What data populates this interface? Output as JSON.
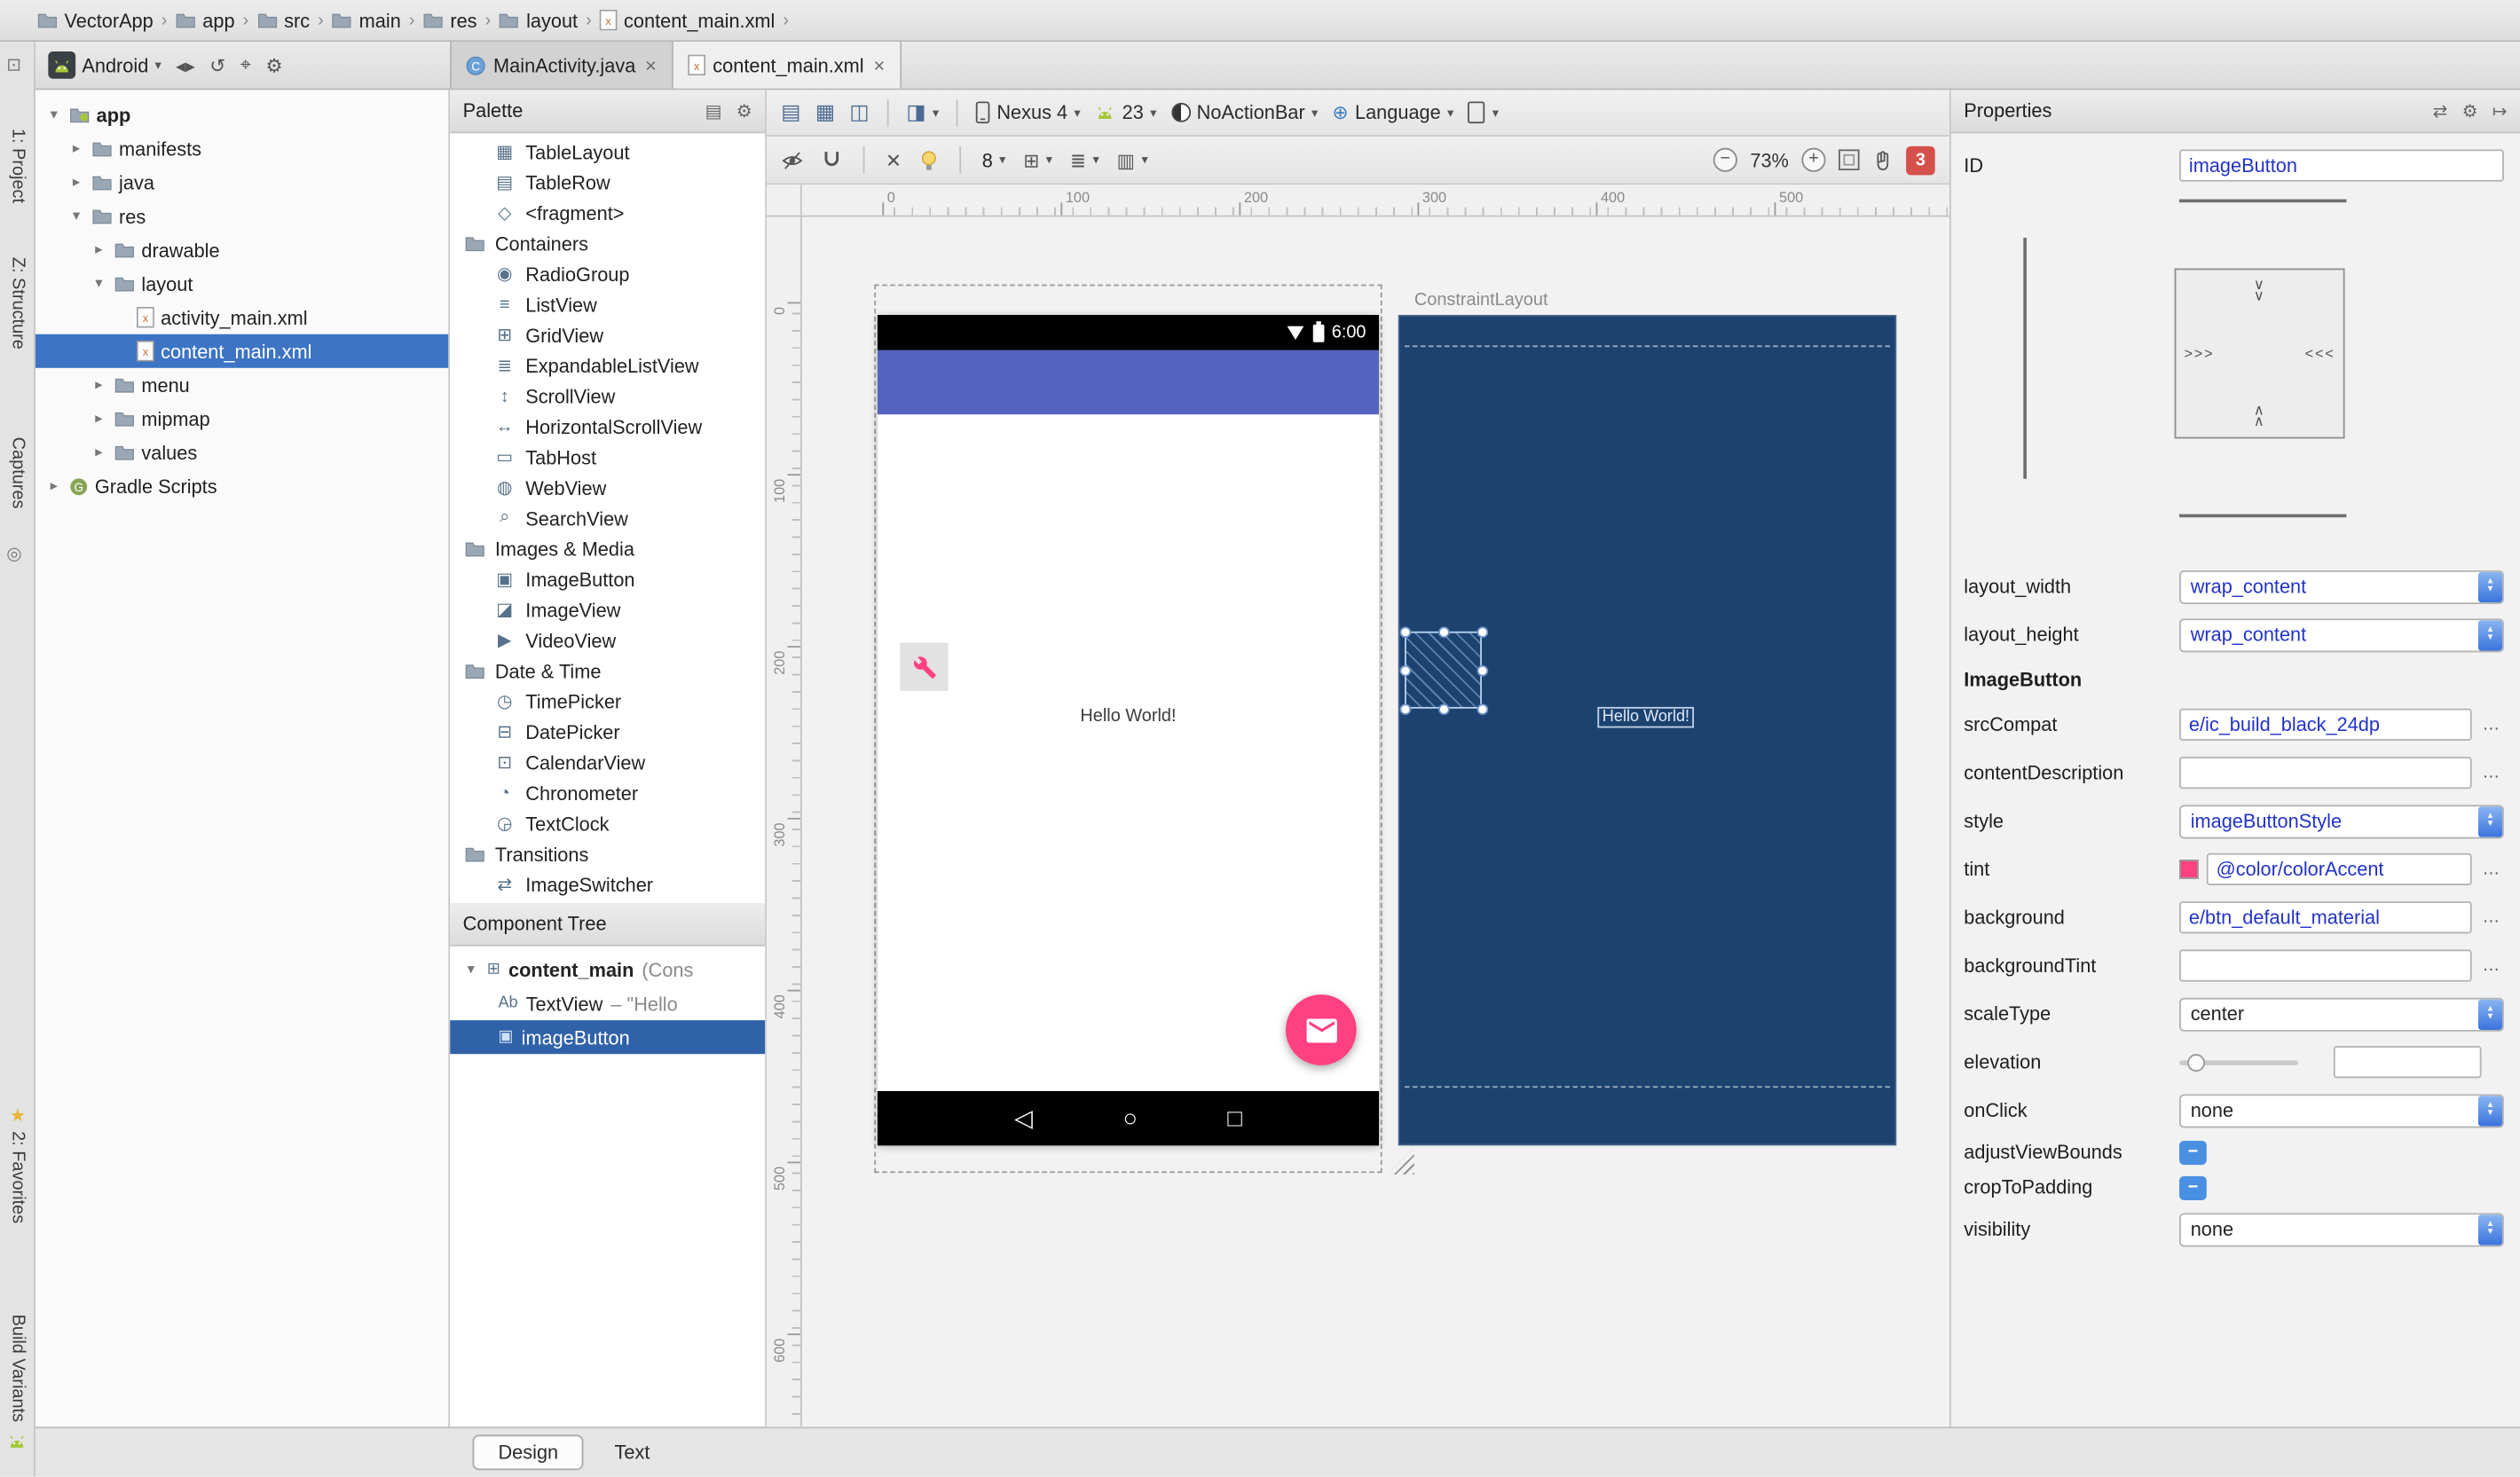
{
  "colors": {
    "accent": "#FF4081",
    "app_bar": "#5564BE",
    "blueprint_bg": "#1C4370",
    "selection_blue": "#3D74C4",
    "component_selection": "#2F62A8",
    "error_badge": "#D6504A",
    "value_text": "#2233C8"
  },
  "breadcrumbs": {
    "separator": "›",
    "items": [
      {
        "label": "VectorApp",
        "icon": "folder-icon"
      },
      {
        "label": "app",
        "icon": "folder-icon"
      },
      {
        "label": "src",
        "icon": "folder-icon"
      },
      {
        "label": "main",
        "icon": "folder-icon"
      },
      {
        "label": "res",
        "icon": "folder-icon"
      },
      {
        "label": "layout",
        "icon": "folder-icon"
      },
      {
        "label": "content_main.xml",
        "icon": "xml-file-icon"
      }
    ]
  },
  "run_toolbar": {
    "config_label": "Android",
    "caret": "▾",
    "icons": [
      {
        "name": "nav-back-forward-icon",
        "glyph": "◂▸"
      },
      {
        "name": "sync-icon",
        "glyph": "↺"
      },
      {
        "name": "locate-icon",
        "glyph": "⌖"
      },
      {
        "name": "settings-gear-icon",
        "glyph": "⚙"
      }
    ]
  },
  "editor_tabs": [
    {
      "label": "MainActivity.java",
      "icon": "java-class-icon",
      "close": "×",
      "active": false
    },
    {
      "label": "content_main.xml",
      "icon": "xml-file-icon",
      "close": "×",
      "active": true
    }
  ],
  "tool_strip": {
    "labels": [
      {
        "label": "1: Project"
      },
      {
        "label": "Z: Structure"
      },
      {
        "label": "Captures"
      },
      {
        "label": "2: Favorites",
        "star": true
      },
      {
        "label": "Build Variants"
      }
    ]
  },
  "project_tree": {
    "rows": [
      {
        "label": "app",
        "depth": 0,
        "arrow": "expanded",
        "icon": "app-folder-icon",
        "bold": true
      },
      {
        "label": "manifests",
        "depth": 1,
        "arrow": "collapsed",
        "icon": "folder-icon"
      },
      {
        "label": "java",
        "depth": 1,
        "arrow": "collapsed",
        "icon": "folder-icon"
      },
      {
        "label": "res",
        "depth": 1,
        "arrow": "expanded",
        "icon": "res-folder-icon"
      },
      {
        "label": "drawable",
        "depth": 2,
        "arrow": "collapsed",
        "icon": "folder-icon"
      },
      {
        "label": "layout",
        "depth": 2,
        "arrow": "expanded",
        "icon": "folder-icon"
      },
      {
        "label": "activity_main.xml",
        "depth": 3,
        "arrow": "none",
        "icon": "xml-file-icon"
      },
      {
        "label": "content_main.xml",
        "depth": 3,
        "arrow": "none",
        "icon": "xml-file-icon",
        "selected": true
      },
      {
        "label": "menu",
        "depth": 2,
        "arrow": "collapsed",
        "icon": "folder-icon"
      },
      {
        "label": "mipmap",
        "depth": 2,
        "arrow": "collapsed",
        "icon": "folder-icon"
      },
      {
        "label": "values",
        "depth": 2,
        "arrow": "collapsed",
        "icon": "folder-icon"
      },
      {
        "label": "Gradle Scripts",
        "depth": 0,
        "arrow": "collapsed",
        "icon": "gradle-icon"
      }
    ]
  },
  "palette": {
    "title": "Palette",
    "header_icons": [
      {
        "name": "palette-view-mode-icon",
        "glyph": "▤"
      },
      {
        "name": "palette-gear-icon",
        "glyph": "⚙"
      }
    ],
    "items": [
      {
        "label": "TableLayout",
        "icon": "tablelayout-icon",
        "glyph": "▦"
      },
      {
        "label": "TableRow",
        "icon": "tablerow-icon",
        "glyph": "▤"
      },
      {
        "label": "<fragment>",
        "icon": "fragment-icon",
        "glyph": "◇"
      },
      {
        "label": "Containers",
        "type": "header",
        "icon": "folder-icon"
      },
      {
        "label": "RadioGroup",
        "icon": "radiogroup-icon",
        "glyph": "◉"
      },
      {
        "label": "ListView",
        "icon": "listview-icon",
        "glyph": "≡"
      },
      {
        "label": "GridView",
        "icon": "gridview-icon",
        "glyph": "⊞"
      },
      {
        "label": "ExpandableListView",
        "icon": "expandablelistview-icon",
        "glyph": "≣"
      },
      {
        "label": "ScrollView",
        "icon": "scrollview-icon",
        "glyph": "↕"
      },
      {
        "label": "HorizontalScrollView",
        "icon": "horizontalscrollview-icon",
        "glyph": "↔"
      },
      {
        "label": "TabHost",
        "icon": "tabhost-icon",
        "glyph": "▭"
      },
      {
        "label": "WebView",
        "icon": "webview-icon",
        "glyph": "◍"
      },
      {
        "label": "SearchView",
        "icon": "searchview-icon",
        "glyph": "⌕"
      },
      {
        "label": "Images & Media",
        "type": "header",
        "icon": "folder-icon"
      },
      {
        "label": "ImageButton",
        "icon": "imagebutton-icon",
        "glyph": "▣"
      },
      {
        "label": "ImageView",
        "icon": "imageview-icon",
        "glyph": "◪"
      },
      {
        "label": "VideoView",
        "icon": "videoview-icon",
        "glyph": "▶"
      },
      {
        "label": "Date & Time",
        "type": "header",
        "icon": "folder-icon"
      },
      {
        "label": "TimePicker",
        "icon": "timepicker-icon",
        "glyph": "◷"
      },
      {
        "label": "DatePicker",
        "icon": "datepicker-icon",
        "glyph": "⊟"
      },
      {
        "label": "CalendarView",
        "icon": "calendarview-icon",
        "glyph": "⊡"
      },
      {
        "label": "Chronometer",
        "icon": "chronometer-icon",
        "glyph": "◔"
      },
      {
        "label": "TextClock",
        "icon": "textclock-icon",
        "glyph": "◶"
      },
      {
        "label": "Transitions",
        "type": "header",
        "icon": "folder-icon"
      },
      {
        "label": "ImageSwitcher",
        "icon": "imageswitcher-icon",
        "glyph": "⇄"
      }
    ]
  },
  "component_tree": {
    "title": "Component Tree",
    "rows": [
      {
        "label": "content_main",
        "suffix": " (Cons",
        "icon": "constraintlayout-icon",
        "glyph": "⊞",
        "arrow": "expanded",
        "bold": true
      },
      {
        "label": "TextView",
        "suffix": " – \"Hello",
        "icon": "textview-icon",
        "glyph": "Ab",
        "indent": 1
      },
      {
        "label": "imageButton",
        "suffix": "",
        "icon": "imagebutton-icon",
        "glyph": "▣",
        "indent": 1,
        "selected": true
      }
    ]
  },
  "design_toolbar": {
    "device_label": "Nexus 4",
    "api_label": "23",
    "theme_label": "NoActionBar",
    "locale_label": "Language",
    "icons": {
      "design_mode": "▤",
      "blueprint_mode": "▦",
      "both_mode": "◫",
      "theme_editor": "◨",
      "caret": "▾",
      "globe": "⊕"
    }
  },
  "design_toolbar2": {
    "default_margin": "8",
    "zoom_level": "73%",
    "error_count": "3",
    "icons": {
      "clear_constraints": "✕",
      "guideline": "⊞",
      "align": "≣",
      "pack": "▥",
      "zoom_out": "−",
      "zoom_in": "+"
    }
  },
  "rulers": {
    "h_labels": [
      "0",
      "100",
      "200",
      "300",
      "400",
      "500"
    ],
    "v_labels": [
      "0",
      "100",
      "200",
      "300",
      "400",
      "500",
      "600"
    ]
  },
  "design_preview": {
    "status_time": "6:00",
    "hello_text": "Hello World!",
    "nav_icons": {
      "back": "◁",
      "home": "○",
      "recents": "□"
    }
  },
  "blueprint": {
    "root_label": "ConstraintLayout",
    "textview_text": "Hello World!"
  },
  "properties": {
    "title": "Properties",
    "header_icons": [
      {
        "name": "switch-layout-icon",
        "glyph": "⇄"
      },
      {
        "name": "properties-gear-icon",
        "glyph": "⚙"
      },
      {
        "name": "move-to-end-icon",
        "glyph": "↦"
      }
    ],
    "rows": [
      {
        "label": "ID",
        "type": "text",
        "value": "imageButton"
      },
      {
        "type": "constraint-widget"
      },
      {
        "label": "layout_width",
        "type": "combo",
        "value": "wrap_content"
      },
      {
        "label": "layout_height",
        "type": "combo",
        "value": "wrap_content"
      },
      {
        "label": "ImageButton",
        "type": "section"
      },
      {
        "label": "srcCompat",
        "type": "text",
        "value": "e/ic_build_black_24dp",
        "dots": true
      },
      {
        "label": "contentDescription",
        "type": "text",
        "value": "",
        "dots": true
      },
      {
        "label": "style",
        "type": "combo",
        "value": "imageButtonStyle"
      },
      {
        "label": "tint",
        "type": "text",
        "value": "@color/colorAccent",
        "swatch": "#FF4081",
        "dots": true
      },
      {
        "label": "background",
        "type": "text",
        "value": "e/btn_default_material",
        "dots": true
      },
      {
        "label": "backgroundTint",
        "type": "text",
        "value": "",
        "dots": true
      },
      {
        "label": "scaleType",
        "type": "combo",
        "value": "center",
        "plain": true
      },
      {
        "label": "elevation",
        "type": "slider"
      },
      {
        "label": "onClick",
        "type": "combo",
        "value": "none",
        "plain": true
      },
      {
        "label": "adjustViewBounds",
        "type": "tristate"
      },
      {
        "label": "cropToPadding",
        "type": "tristate"
      },
      {
        "label": "visibility",
        "type": "combo",
        "value": "none",
        "plain": true
      }
    ]
  },
  "bottom_tabs": [
    {
      "label": "Design",
      "active": true
    },
    {
      "label": "Text",
      "active": false
    }
  ]
}
